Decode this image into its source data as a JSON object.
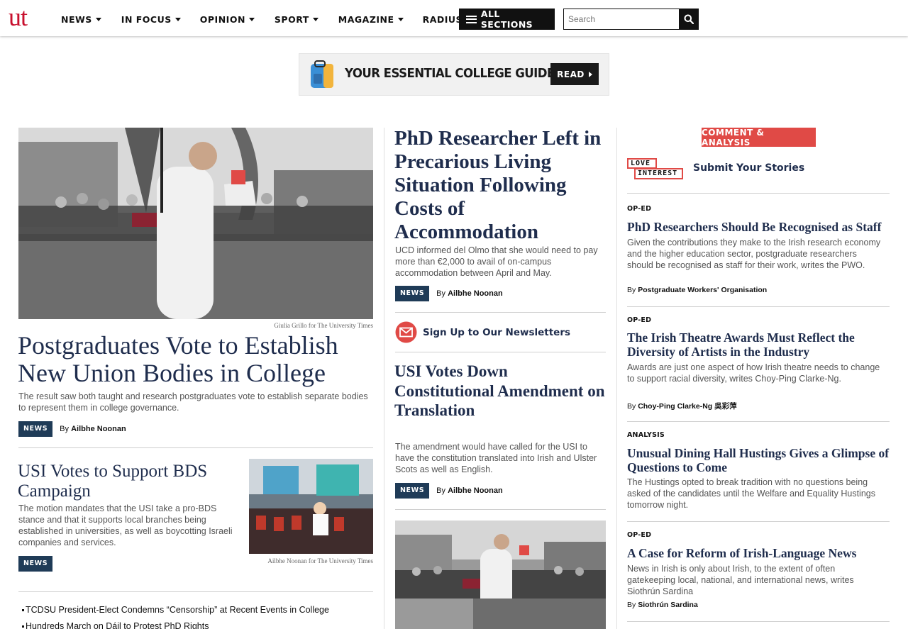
{
  "header": {
    "logo": "ut",
    "nav": [
      {
        "label": "NEWS",
        "caret": true
      },
      {
        "label": "IN FOCUS",
        "caret": true
      },
      {
        "label": "OPINION",
        "caret": true
      },
      {
        "label": "SPORT",
        "caret": true
      },
      {
        "label": "MAGAZINE",
        "caret": true
      },
      {
        "label": "RADIUS",
        "caret": false
      }
    ],
    "all_sections": "ALL SECTIONS",
    "search_placeholder": "Search"
  },
  "ad": {
    "text": "YOUR ESSENTIAL COLLEGE GUIDE",
    "button": "READ"
  },
  "lead": {
    "photo_credit": "Giulia Grillo for The University Times",
    "title": "Postgraduates Vote to Establish New Union Bodies in College",
    "dek": "The result saw both taught and research postgraduates vote to establish separate bodies to represent them in college governance.",
    "tag": "NEWS",
    "by": "By",
    "author": "Ailbhe Noonan"
  },
  "story2": {
    "title": "USI Votes to Support BDS Campaign",
    "dek": "The motion mandates that the USI take a pro-BDS stance and that it supports local branches being established in universities, as well as boycotting Israeli companies and services.",
    "tag": "NEWS",
    "photo_credit": "Ailbhe Noonan for The University Times"
  },
  "headline_list": [
    "TCDSU President-Elect Condemns “Censorship” at Recent Events in College",
    "Hundreds March on Dáil to Protest PhD Rights"
  ],
  "middle": {
    "main": {
      "title": "PhD Researcher Left in Precarious Living Situation Following Costs of Accommodation",
      "dek": "UCD informed del Olmo that she would need to pay more than €2,000 to avail of on-campus accommodation between April and May.",
      "tag": "NEWS",
      "by": "By",
      "author": "Ailbhe Noonan"
    },
    "newsletter": "Sign Up to Our Newsletters",
    "second": {
      "title": "USI Votes Down Constitutional Amendment on Translation",
      "dek": "The amendment would have called for the USI to have the constitution translated into Irish and Ulster Scots as well as English.",
      "tag": "NEWS",
      "by": "By",
      "author": "Ailbhe Noonan"
    }
  },
  "comment": {
    "section": "COMMENT & ANALYSIS",
    "love": "LOVE",
    "interest": "INTEREST",
    "submit": "Submit Your Stories",
    "items": [
      {
        "label": "OP-ED",
        "title": "PhD Researchers Should Be Recognised as Staff",
        "dek": "Given the contributions they make to the Irish research economy and the higher education sector, postgraduate researchers should be recognised as staff for their work, writes the PWO.",
        "by": "By",
        "author": "Postgraduate Workers' Organisation"
      },
      {
        "label": "OP-ED",
        "title": "The Irish Theatre Awards Must Reflect the Diversity of Artists in the Industry",
        "dek": "Awards are just one aspect of how Irish theatre needs to change to support racial diversity, writes Choy-Ping Clarke-Ng.",
        "by": "By",
        "author": "Choy-Ping Clarke-Ng 吳彩萍"
      },
      {
        "label": "ANALYSIS",
        "title": "Unusual Dining Hall Hustings Gives a Glimpse of Questions to Come",
        "dek": "The Hustings opted to break tradition with no questions being asked of the candidates until the Welfare and Equality Hustings tomorrow night."
      },
      {
        "label": "OP-ED",
        "title": "A Case for Reform of Irish-Language News",
        "dek": "News in Irish is only about Irish, to the extent of often gatekeeping local, national, and international news, writes Siothrún Sardina",
        "by": "By",
        "author": "Siothrún Sardina"
      }
    ]
  },
  "colors": {
    "brand_red": "#c8102e",
    "tag_navy": "#1f3b57",
    "comment_red": "#e04a46",
    "headline_navy": "#1f2d4d"
  }
}
